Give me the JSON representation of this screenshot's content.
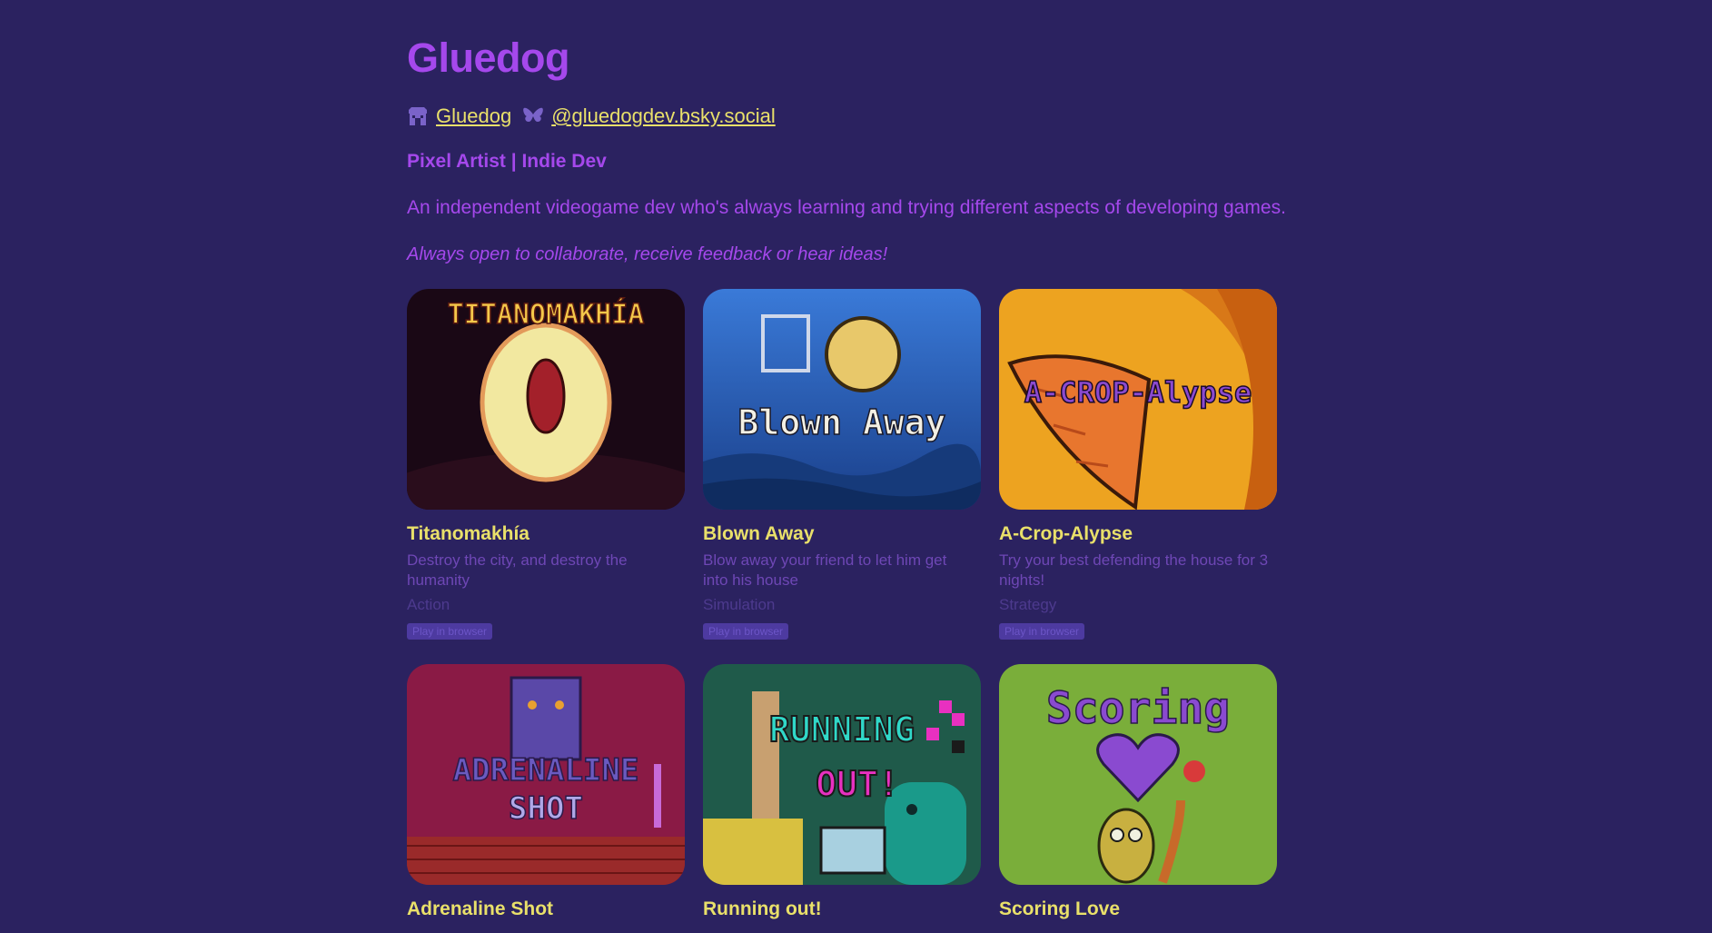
{
  "profile": {
    "name": "Gluedog",
    "links": [
      {
        "icon": "itchio-icon",
        "label": "Gluedog"
      },
      {
        "icon": "butterfly-icon",
        "label": "@gluedogdev.bsky.social"
      }
    ],
    "tagline": "Pixel Artist | Indie Dev",
    "description": "An independent videogame dev who's always learning and trying different aspects of developing games.",
    "note": "Always open to collaborate, receive feedback or hear ideas!"
  },
  "games": [
    {
      "title": "Titanomakhía",
      "cover_text": "TITANOMAKHÍA",
      "description": "Destroy the city, and destroy the humanity",
      "genre": "Action",
      "badge": "Play in browser"
    },
    {
      "title": "Blown Away",
      "cover_text": "Blown Away",
      "description": "Blow away your friend to let him get into his house",
      "genre": "Simulation",
      "badge": "Play in browser"
    },
    {
      "title": "A-Crop-Alypse",
      "cover_text": "A-CROP-Alypse",
      "description": "Try your best defending the house for 3 nights!",
      "genre": "Strategy",
      "badge": "Play in browser"
    },
    {
      "title": "Adrenaline Shot",
      "cover_text_1": "ADRENALINE",
      "cover_text_2": "SHOT"
    },
    {
      "title": "Running out!",
      "cover_text_1": "RUNNING",
      "cover_text_2": "OUT!"
    },
    {
      "title": "Scoring Love",
      "cover_text": "Scoring"
    }
  ],
  "colors": {
    "background": "#2b2260",
    "accent": "#a548ec",
    "link": "#e9e06a",
    "card_title": "#e9e06a",
    "muted": "#6e47b5"
  }
}
